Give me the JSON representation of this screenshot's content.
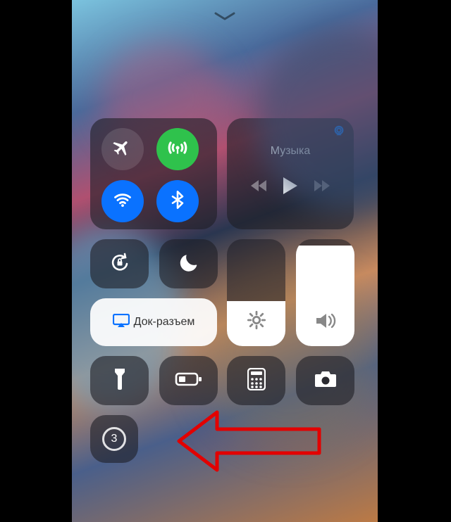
{
  "media": {
    "title": "Музыка"
  },
  "mirror": {
    "label": "Док-разъем"
  },
  "record": {
    "countdown": "3"
  },
  "brightness": {
    "level_pct": 42
  },
  "volume": {
    "level_pct": 94
  }
}
